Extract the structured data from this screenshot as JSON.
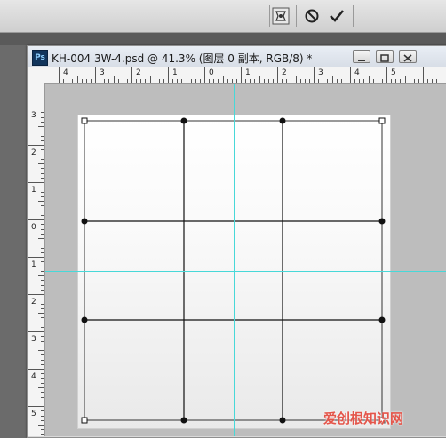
{
  "window": {
    "app_icon": "Ps",
    "title": "KH-004 3W-4.psd @ 41.3% (图层 0 副本, RGB/8) *"
  },
  "toolbar": {
    "icons": [
      "transform-mode-icon",
      "cancel-icon",
      "commit-icon"
    ]
  },
  "rulers": {
    "horizontal_labels": [
      "4",
      "3",
      "2",
      "1",
      "0",
      "1",
      "2",
      "3",
      "4",
      "5"
    ],
    "vertical_labels": [
      "3",
      "2",
      "1",
      "0",
      "1",
      "2",
      "3",
      "4",
      "5"
    ]
  },
  "watermark": "爱创根知识网"
}
